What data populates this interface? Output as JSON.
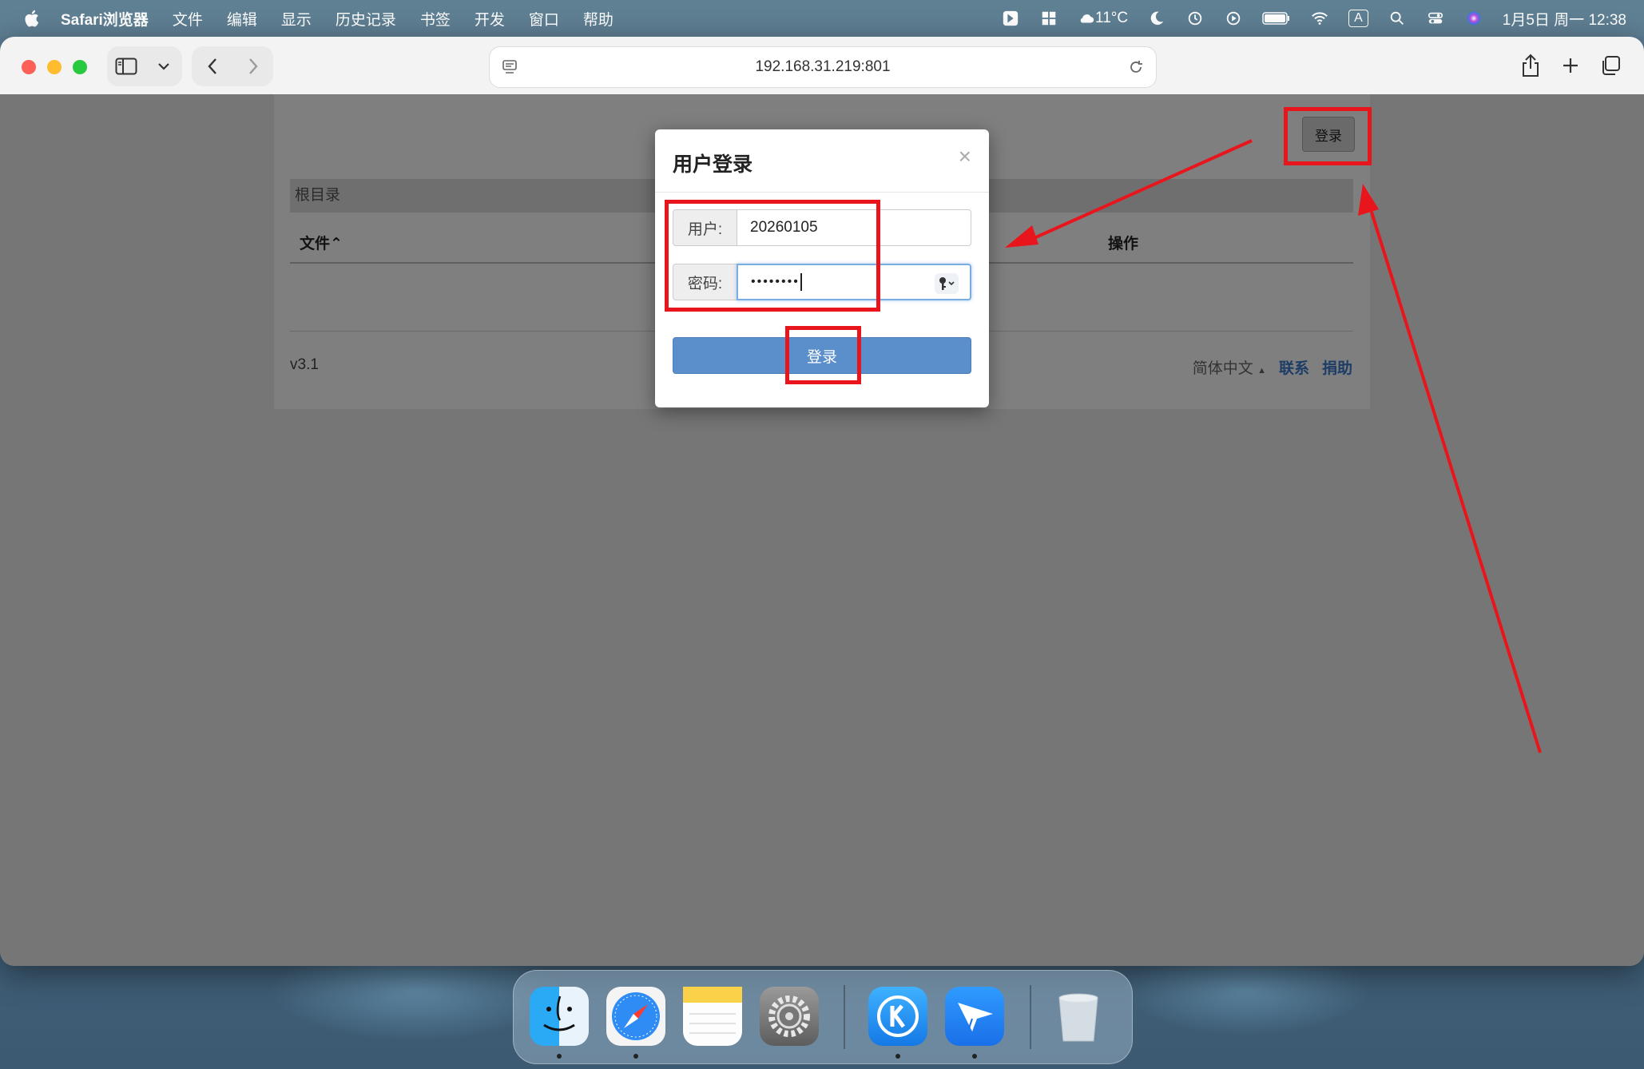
{
  "menubar": {
    "items": [
      "Safari浏览器",
      "文件",
      "编辑",
      "显示",
      "历史记录",
      "书签",
      "开发",
      "窗口",
      "帮助"
    ],
    "weather": "11°C",
    "datetime": "1月5日 周一  12:38",
    "input_indicator": "A"
  },
  "browser": {
    "url": "192.168.31.219:801"
  },
  "page": {
    "top_login_label": "登录",
    "breadcrumb": "根目录",
    "col_file": "文件",
    "col_file_sort": "⌃",
    "col_actions": "操作",
    "version": "v3.1",
    "language": "简体中文",
    "language_caret": "▲",
    "contact_link": "联系",
    "donate_link": "捐助"
  },
  "modal": {
    "title": "用户登录",
    "close": "×",
    "user_label": "用户:",
    "user_value": "20260105",
    "password_label": "密码:",
    "password_mask": "••••••••",
    "submit_label": "登录"
  },
  "colors": {
    "annotation": "#e8161c",
    "submit_button": "#5a8fcb",
    "link": "#1d3d66"
  },
  "dock": {
    "icons": [
      "finder-icon",
      "safari-icon",
      "notes-icon",
      "system-settings-icon",
      "kuaijie-k-icon",
      "feishu-icon",
      "trash-icon"
    ]
  }
}
